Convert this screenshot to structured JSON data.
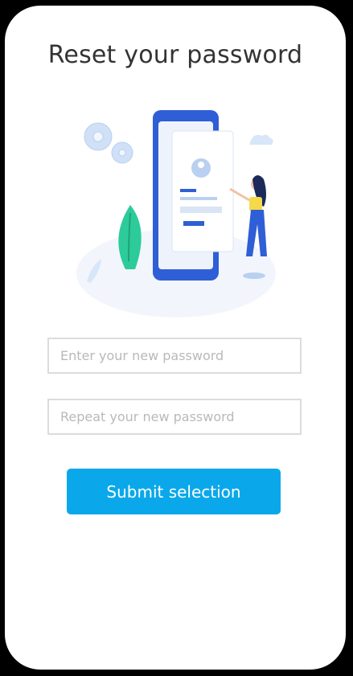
{
  "screen": {
    "title": "Reset your password"
  },
  "form": {
    "new_password_placeholder": "Enter your new password",
    "repeat_password_placeholder": "Repeat your new password",
    "submit_label": "Submit selection"
  },
  "illustration": {
    "icon": "reset-password-illustration",
    "colors": {
      "phone": "#2f5fd6",
      "screen": "#eef3fb",
      "leaf": "#2ecb9a",
      "gears": "#cfe0f7",
      "shirt": "#f6d94a",
      "pants": "#2f5fd6"
    }
  },
  "theme": {
    "accent": "#0aa8ea"
  }
}
